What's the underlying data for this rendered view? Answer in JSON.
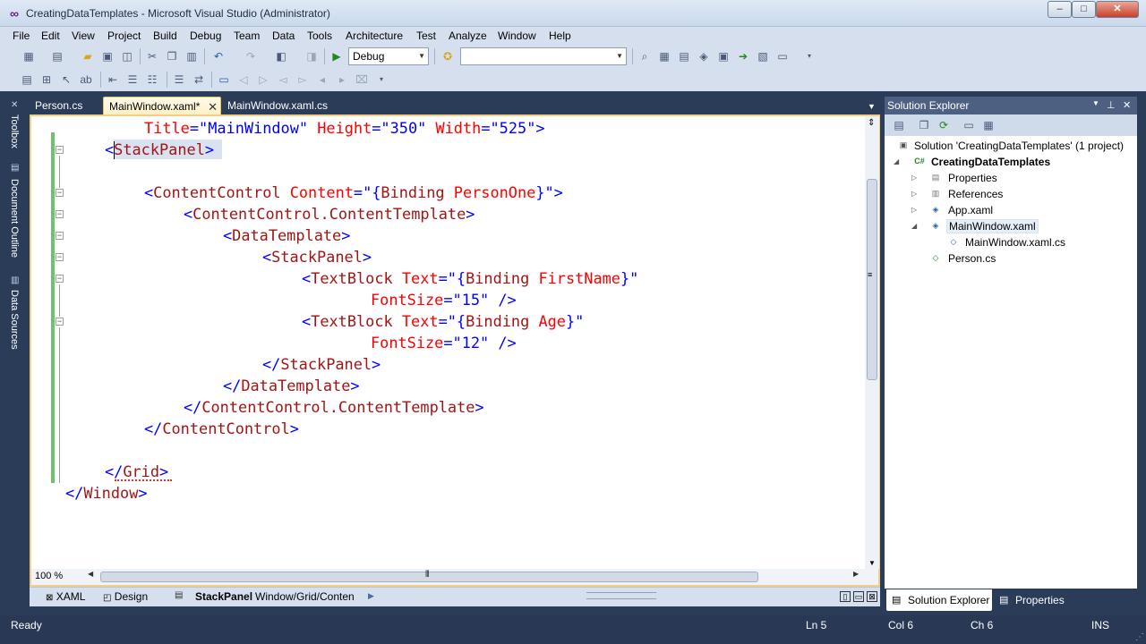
{
  "window": {
    "title": "CreatingDataTemplates - Microsoft Visual Studio (Administrator)",
    "min_glyph": "–",
    "max_glyph": "□",
    "close_glyph": "✕"
  },
  "menu": [
    "File",
    "Edit",
    "View",
    "Project",
    "Build",
    "Debug",
    "Team",
    "Data",
    "Tools",
    "Architecture",
    "Test",
    "Analyze",
    "Window",
    "Help"
  ],
  "toolbar": {
    "config_combo": "Debug",
    "platform_combo": ""
  },
  "left_strip": {
    "toolbox": "Toolbox",
    "document_outline": "Document Outline",
    "data_sources": "Data Sources"
  },
  "tabs": [
    {
      "label": "Person.cs"
    },
    {
      "label": "MainWindow.xaml*"
    },
    {
      "label": "MainWindow.xaml.cs"
    }
  ],
  "editor": {
    "lines": [
      [
        {
          "c": "a",
          "t": "Title"
        },
        {
          "c": "b",
          "t": "=\""
        },
        {
          "c": "v",
          "t": "MainWindow"
        },
        {
          "c": "b",
          "t": "\" "
        },
        {
          "c": "a",
          "t": "Height"
        },
        {
          "c": "b",
          "t": "=\""
        },
        {
          "c": "v",
          "t": "350"
        },
        {
          "c": "b",
          "t": "\" "
        },
        {
          "c": "a",
          "t": "Width"
        },
        {
          "c": "b",
          "t": "=\""
        },
        {
          "c": "v",
          "t": "525"
        },
        {
          "c": "b",
          "t": "\">"
        }
      ],
      [
        {
          "c": "b",
          "t": "<"
        },
        {
          "c": "t",
          "t": "StackPanel"
        },
        {
          "c": "b",
          "t": ">"
        }
      ],
      [],
      [
        {
          "c": "b",
          "t": "<"
        },
        {
          "c": "t",
          "t": "ContentControl"
        },
        {
          "c": "b",
          "t": " "
        },
        {
          "c": "a",
          "t": "Content"
        },
        {
          "c": "b",
          "t": "=\"{"
        },
        {
          "c": "t",
          "t": "Binding"
        },
        {
          "c": "b",
          "t": " "
        },
        {
          "c": "a",
          "t": "PersonOne"
        },
        {
          "c": "b",
          "t": "}\">"
        }
      ],
      [
        {
          "c": "b",
          "t": "<"
        },
        {
          "c": "t",
          "t": "ContentControl.ContentTemplate"
        },
        {
          "c": "b",
          "t": ">"
        }
      ],
      [
        {
          "c": "b",
          "t": "<"
        },
        {
          "c": "t",
          "t": "DataTemplate"
        },
        {
          "c": "b",
          "t": ">"
        }
      ],
      [
        {
          "c": "b",
          "t": "<"
        },
        {
          "c": "t",
          "t": "StackPanel"
        },
        {
          "c": "b",
          "t": ">"
        }
      ],
      [
        {
          "c": "b",
          "t": "<"
        },
        {
          "c": "t",
          "t": "TextBlock"
        },
        {
          "c": "b",
          "t": " "
        },
        {
          "c": "a",
          "t": "Text"
        },
        {
          "c": "b",
          "t": "=\"{"
        },
        {
          "c": "t",
          "t": "Binding"
        },
        {
          "c": "b",
          "t": " "
        },
        {
          "c": "a",
          "t": "FirstName"
        },
        {
          "c": "b",
          "t": "}\""
        }
      ],
      [
        {
          "c": "a",
          "t": "FontSize"
        },
        {
          "c": "b",
          "t": "=\""
        },
        {
          "c": "v",
          "t": "15"
        },
        {
          "c": "b",
          "t": "\" />"
        }
      ],
      [
        {
          "c": "b",
          "t": "<"
        },
        {
          "c": "t",
          "t": "TextBlock"
        },
        {
          "c": "b",
          "t": " "
        },
        {
          "c": "a",
          "t": "Text"
        },
        {
          "c": "b",
          "t": "=\"{"
        },
        {
          "c": "t",
          "t": "Binding"
        },
        {
          "c": "b",
          "t": " "
        },
        {
          "c": "a",
          "t": "Age"
        },
        {
          "c": "b",
          "t": "}\""
        }
      ],
      [
        {
          "c": "a",
          "t": "FontSize"
        },
        {
          "c": "b",
          "t": "=\""
        },
        {
          "c": "v",
          "t": "12"
        },
        {
          "c": "b",
          "t": "\" />"
        }
      ],
      [
        {
          "c": "b",
          "t": "</"
        },
        {
          "c": "t",
          "t": "StackPanel"
        },
        {
          "c": "b",
          "t": ">"
        }
      ],
      [
        {
          "c": "b",
          "t": "</"
        },
        {
          "c": "t",
          "t": "DataTemplate"
        },
        {
          "c": "b",
          "t": ">"
        }
      ],
      [
        {
          "c": "b",
          "t": "</"
        },
        {
          "c": "t",
          "t": "ContentControl.ContentTemplate"
        },
        {
          "c": "b",
          "t": ">"
        }
      ],
      [
        {
          "c": "b",
          "t": "</"
        },
        {
          "c": "t",
          "t": "ContentControl"
        },
        {
          "c": "b",
          "t": ">"
        }
      ],
      [],
      [
        {
          "c": "b",
          "t": "</"
        },
        {
          "c": "t",
          "t": "Grid"
        },
        {
          "c": "b",
          "t": ">"
        }
      ],
      [
        {
          "c": "b",
          "t": "</"
        },
        {
          "c": "t",
          "t": "Window"
        },
        {
          "c": "b",
          "t": ">"
        }
      ]
    ]
  },
  "zoom": "100 %",
  "viewbar": {
    "xaml": "XAML",
    "design": "Design",
    "crumb_element": "StackPanel",
    "crumb_path": "Window/Grid/Conten"
  },
  "solution_explorer": {
    "title": "Solution Explorer",
    "nodes": {
      "solution": "Solution 'CreatingDataTemplates' (1 project)",
      "project": "CreatingDataTemplates",
      "properties": "Properties",
      "references": "References",
      "app": "App.xaml",
      "mainwindow": "MainWindow.xaml",
      "mainwindow_cs": "MainWindow.xaml.cs",
      "person": "Person.cs"
    },
    "tab_solution": "Solution Explorer",
    "tab_properties": "Properties"
  },
  "status": {
    "ready": "Ready",
    "ln": "Ln 5",
    "col": "Col 6",
    "ch": "Ch 6",
    "ins": "INS"
  }
}
